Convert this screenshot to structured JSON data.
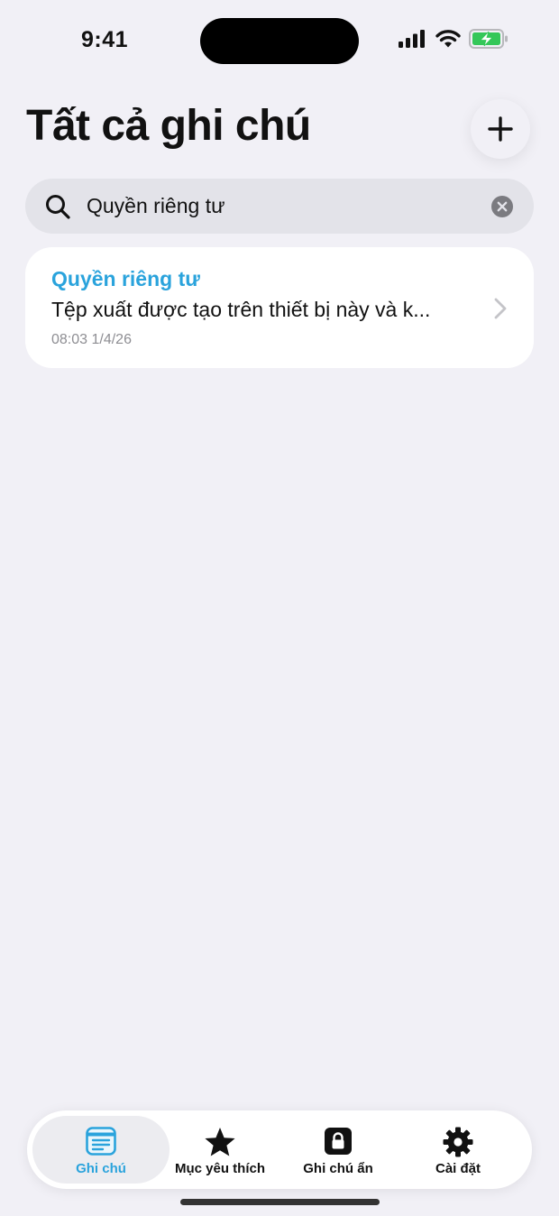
{
  "status_bar": {
    "time": "9:41"
  },
  "header": {
    "title": "Tất cả ghi chú",
    "add_icon": "plus-icon"
  },
  "search": {
    "value": "Quyền riêng tư",
    "icon": "magnifying-glass-icon",
    "clear_icon": "xmark-circle-icon"
  },
  "notes": [
    {
      "title": "Quyền riêng tư",
      "preview": "Tệp xuất được tạo trên thiết bị này và k...",
      "date": "08:03 1/4/26"
    }
  ],
  "tab_bar": {
    "tabs": [
      {
        "label": "Ghi chú",
        "icon": "note-icon",
        "active": true
      },
      {
        "label": "Mục yêu thích",
        "icon": "star-icon",
        "active": false
      },
      {
        "label": "Ghi chú ẩn",
        "icon": "lock-icon",
        "active": false
      },
      {
        "label": "Cài đặt",
        "icon": "gear-icon",
        "active": false
      }
    ]
  },
  "colors": {
    "accent": "#2aa3dc",
    "background": "#f1f0f6",
    "card": "#ffffff",
    "search_field": "#e3e3e9",
    "battery_green": "#34c759"
  }
}
